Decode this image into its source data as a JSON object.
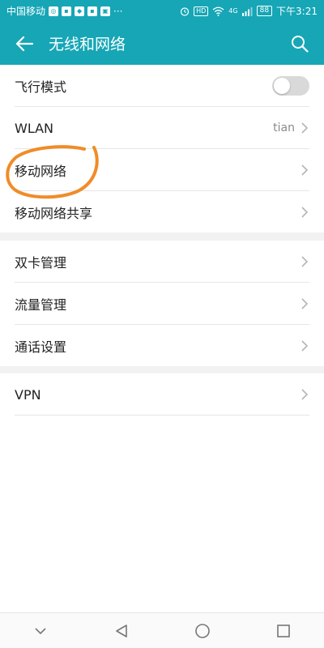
{
  "status_bar": {
    "carrier": "中国移动",
    "more": "···",
    "hd": "HD",
    "network": "4G",
    "battery": "88",
    "time": "下午3:21"
  },
  "app_bar": {
    "title": "无线和网络"
  },
  "sections": [
    {
      "items": [
        {
          "label": "飞行模式",
          "type": "toggle",
          "toggle_on": false
        },
        {
          "label": "WLAN",
          "value": "tian"
        },
        {
          "label": "移动网络"
        },
        {
          "label": "移动网络共享"
        }
      ]
    },
    {
      "items": [
        {
          "label": "双卡管理"
        },
        {
          "label": "流量管理"
        },
        {
          "label": "通话设置"
        }
      ]
    },
    {
      "items": [
        {
          "label": "VPN"
        }
      ]
    }
  ],
  "colors": {
    "accent": "#16a6b6",
    "annotation": "#f08c28"
  }
}
